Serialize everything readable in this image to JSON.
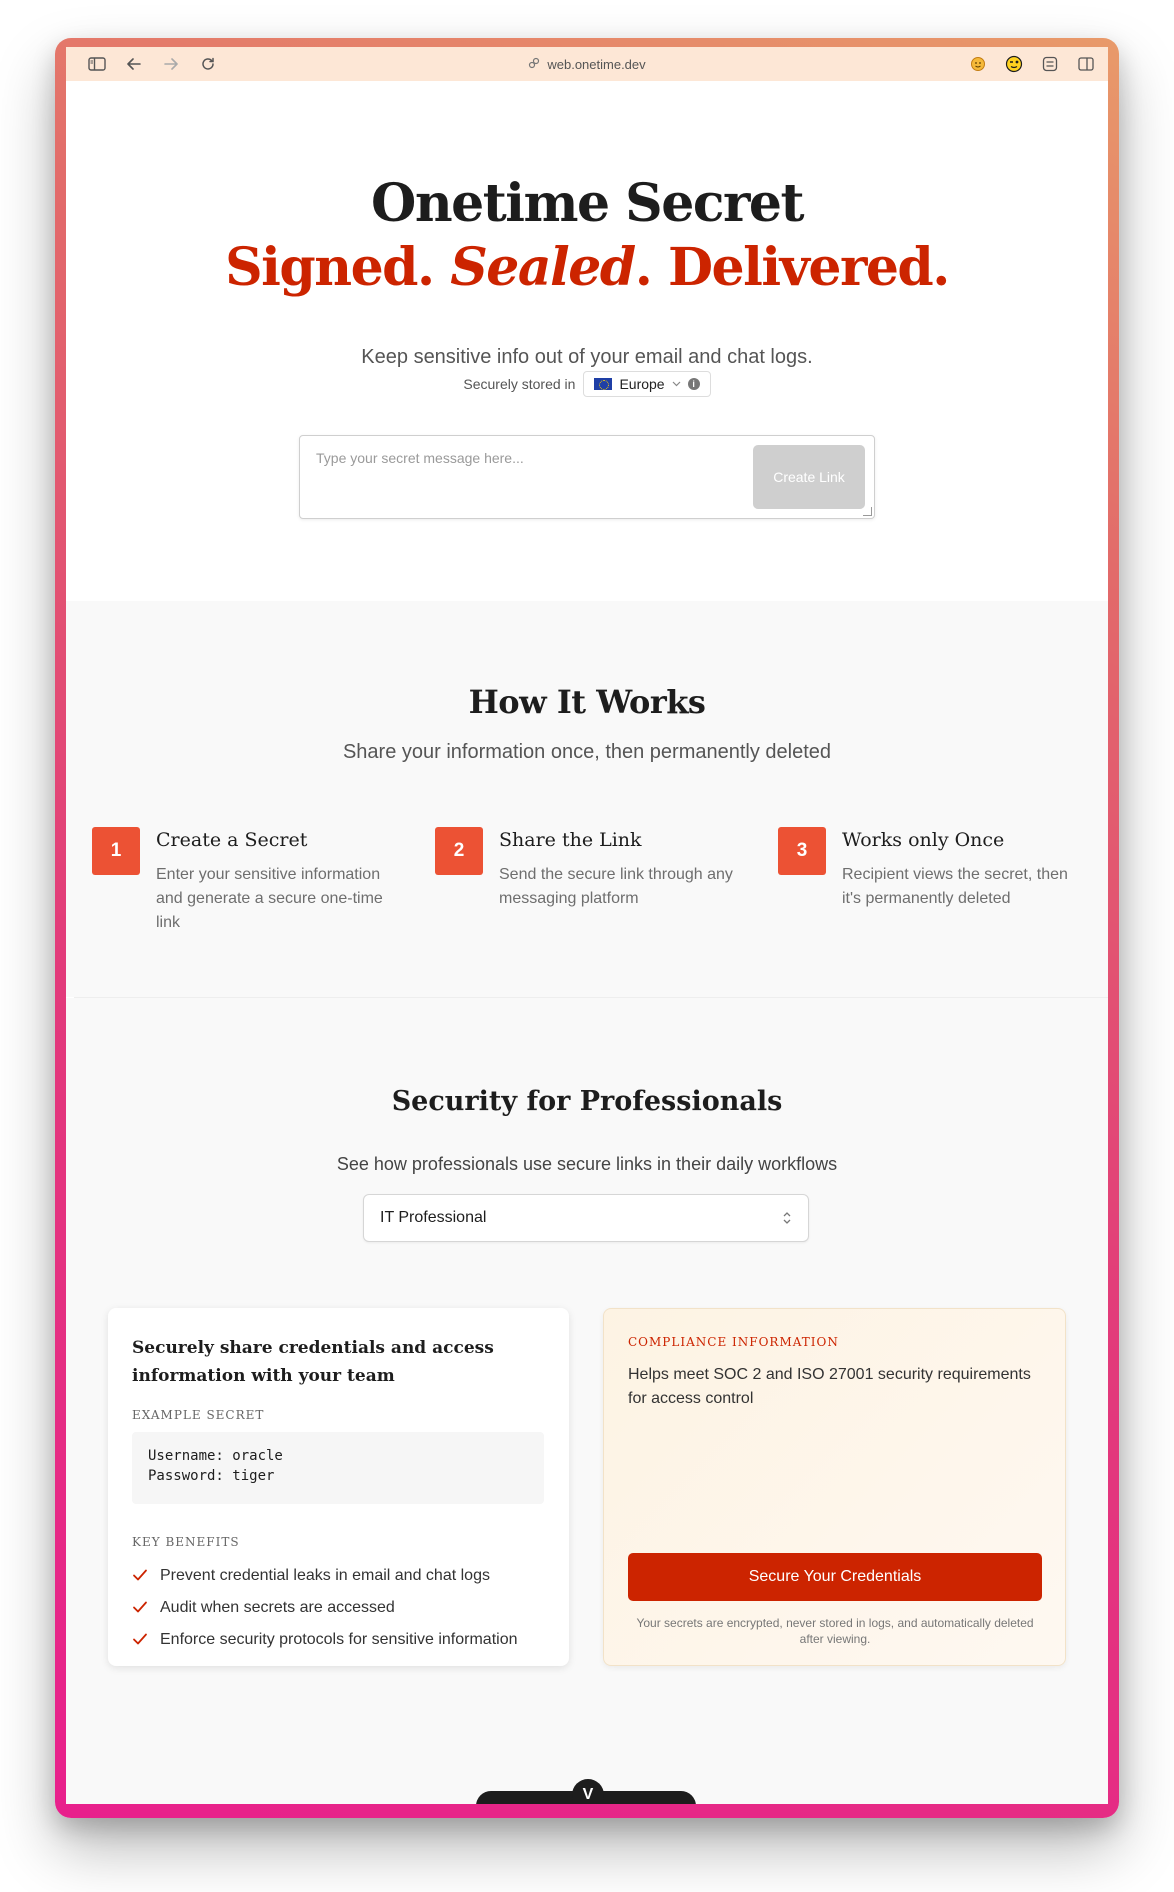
{
  "browser": {
    "url": "web.onetime.dev",
    "icons": [
      "sidebar-icon",
      "back-icon",
      "forward-icon",
      "reload-icon",
      "lock-icon",
      "extension-face-icon",
      "extension-wink-icon",
      "extension-list-icon",
      "split-view-icon"
    ]
  },
  "hero": {
    "title": "Onetime Secret",
    "tag_1": "Signed. ",
    "tag_2": "Sealed",
    "tag_3": ". Delivered.",
    "subtitle": "Keep sensitive info out of your email and chat logs.",
    "stored_label": "Securely stored in",
    "region": "Europe",
    "secret_placeholder": "Type your secret message here...",
    "create_button": "Create Link"
  },
  "how_it_works": {
    "title": "How It Works",
    "subtitle": "Share your information once, then permanently deleted",
    "steps": [
      {
        "num": "1",
        "title": "Create a Secret",
        "desc": "Enter your sensitive information and generate a secure one-time link"
      },
      {
        "num": "2",
        "title": "Share the Link",
        "desc": "Send the secure link through any messaging platform"
      },
      {
        "num": "3",
        "title": "Works only Once",
        "desc": "Recipient views the secret, then it's permanently deleted"
      }
    ]
  },
  "professionals": {
    "title": "Security for Professionals",
    "subtitle": "See how professionals use secure links in their daily workflows",
    "selected_role": "IT Professional",
    "card": {
      "title": "Securely share credentials and access information with your team",
      "example_label": "EXAMPLE SECRET",
      "example_line_1": "Username: oracle",
      "example_line_2": "Password: tiger",
      "benefits_label": "KEY BENEFITS",
      "benefits": [
        "Prevent credential leaks in email and chat logs",
        "Audit when secrets are accessed",
        "Enforce security protocols for sensitive information"
      ]
    },
    "compliance": {
      "label": "COMPLIANCE INFORMATION",
      "text": "Helps meet SOC 2 and ISO 27001 security requirements for access control",
      "button": "Secure Your Credentials",
      "note": "Your secrets are encrypted, never stored in logs, and automatically deleted after viewing."
    }
  },
  "devtools": {
    "logo": "V"
  },
  "colors": {
    "accent": "#cc2400",
    "step_badge": "#ec5234",
    "toolbar": "#fde7d6"
  }
}
